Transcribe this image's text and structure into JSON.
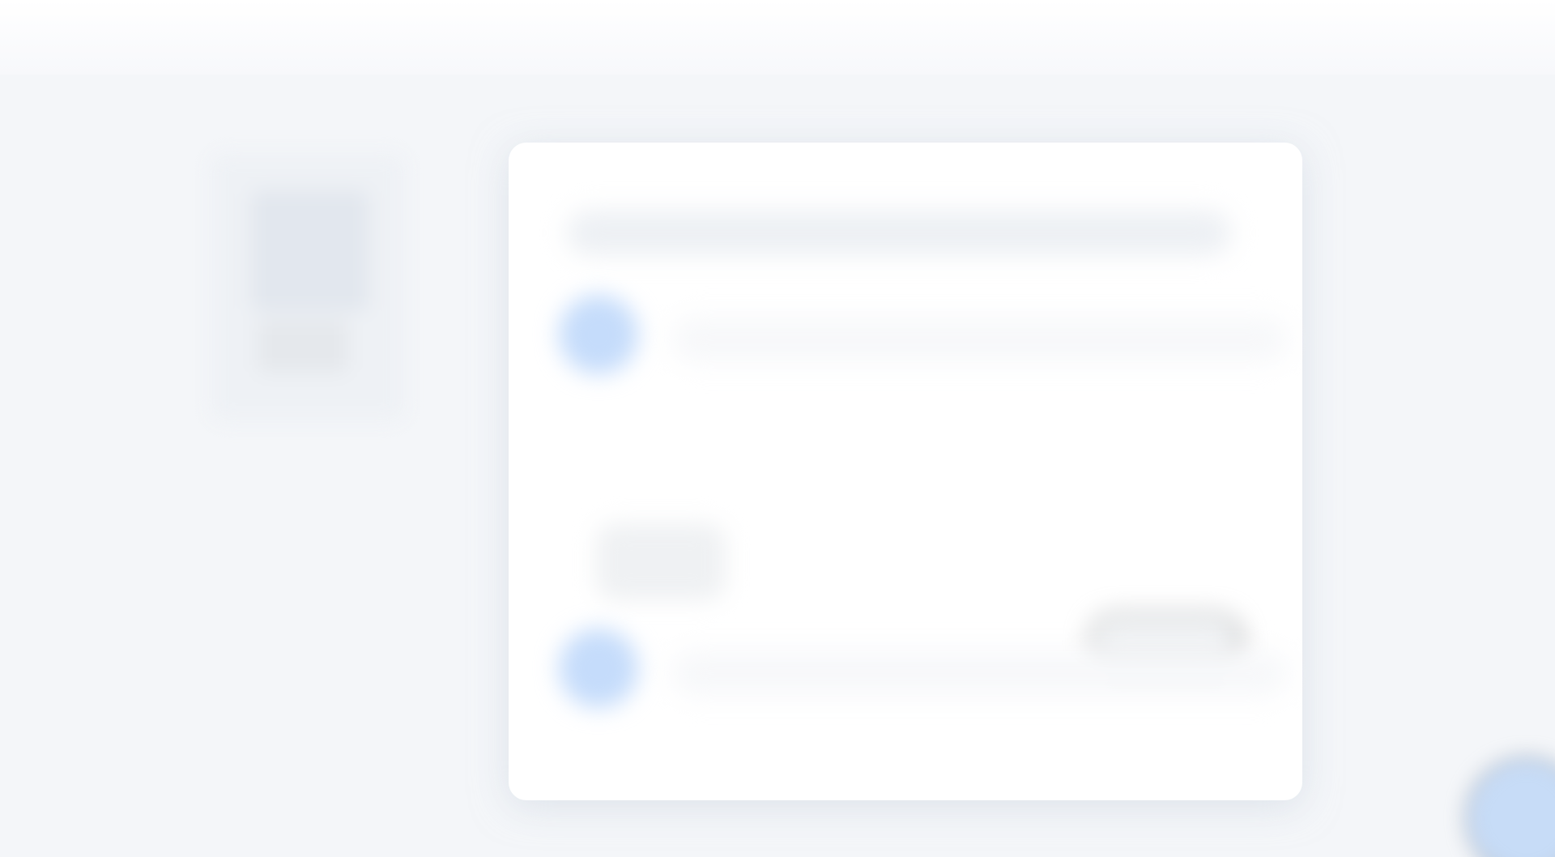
{
  "screen": {
    "colors": {
      "background": "#f4f6f9",
      "card": "#ffffff",
      "accent": "#c5dcfb",
      "placeholder": "#edf0f4"
    },
    "icons": {
      "row_markers": "blue-circle-icon",
      "floating_action": "blue-circle-icon"
    }
  }
}
